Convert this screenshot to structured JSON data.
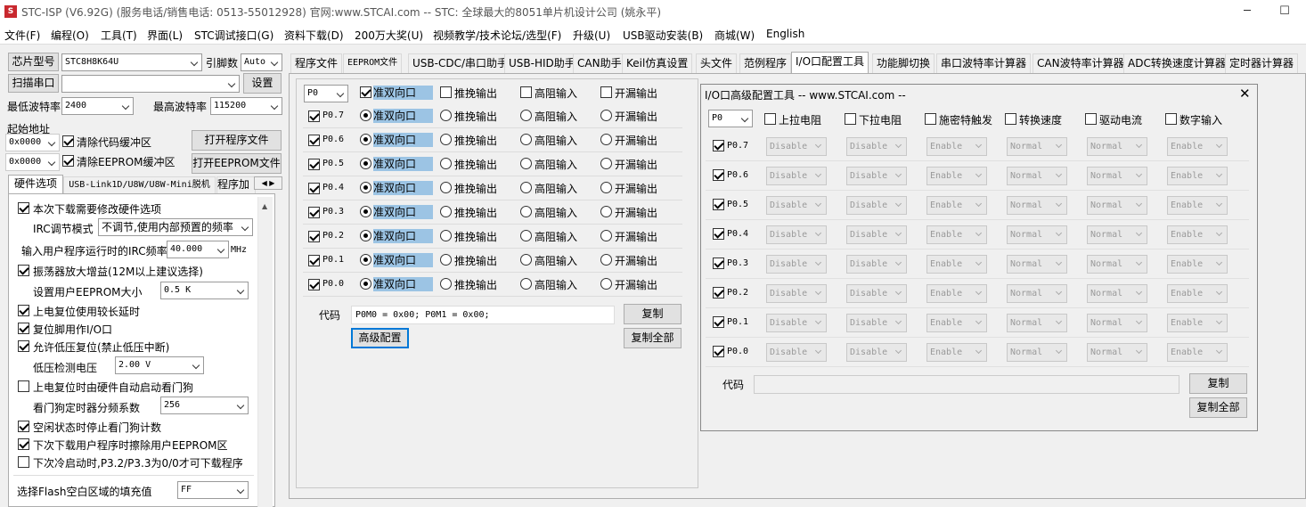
{
  "window": {
    "title": "STC-ISP (V6.92G) (服务电话/销售电话: 0513-55012928) 官网:www.STCAI.com  -- STC: 全球最大的8051单片机设计公司 (姚永平)",
    "minimize": "─",
    "maximize": "☐"
  },
  "menu": [
    "文件(F)",
    "编程(O)",
    "工具(T)",
    "界面(L)",
    "STC调试接口(G)",
    "资料下载(D)",
    "200万大奖(U)",
    "视频教学/技术论坛/选型(F)",
    "升级(U)",
    "USB驱动安装(B)",
    "商城(W)",
    "English"
  ],
  "left": {
    "chip_label": "芯片型号",
    "chip_value": "STC8H8K64U",
    "pin_label": "引脚数",
    "pin_value": "Auto",
    "scan_label": "扫描串口",
    "settings_label": "设置",
    "min_baud_label": "最低波特率",
    "min_baud_value": "2400",
    "max_baud_label": "最高波特率",
    "max_baud_value": "115200",
    "start_addr_label": "起始地址",
    "addr1": "0x0000",
    "clear_code_label": "清除代码缓冲区",
    "open_prog_label": "打开程序文件",
    "addr2": "0x0000",
    "clear_eeprom_label": "清除EEPROM缓冲区",
    "open_eeprom_label": "打开EEPROM文件",
    "subtabs": [
      "硬件选项",
      "USB-Link1D/U8W/U8W-Mini脱机",
      "程序加"
    ],
    "options": {
      "modify_hw": "本次下载需要修改硬件选项",
      "irc_mode_label": "IRC调节模式",
      "irc_mode_value": "不调节,使用内部预置的频率",
      "irc_freq_label": "输入用户程序运行时的IRC频率",
      "irc_freq_value": "40.000",
      "irc_freq_unit": "MHz",
      "osc_gain": "振荡器放大增益(12M以上建议选择)",
      "eeprom_size_label": "设置用户EEPROM大小",
      "eeprom_size_value": "0.5 K",
      "por_delay": "上电复位使用较长延时",
      "reset_pin_io": "复位脚用作I/O口",
      "lvr": "允许低压复位(禁止低压中断)",
      "lvd_label": "低压检测电压",
      "lvd_value": "2.00 V",
      "wdt_auto": "上电复位时由硬件自动启动看门狗",
      "wdt_div_label": "看门狗定时器分频系数",
      "wdt_div_value": "256",
      "wdt_idle": "空闲状态时停止看门狗计数",
      "erase_eeprom": "下次下载用户程序时擦除用户EEPROM区",
      "cold_boot": "下次冷启动时,P3.2/P3.3为0/0才可下载程序",
      "flash_fill_label": "选择Flash空白区域的填充值",
      "flash_fill_value": "FF"
    }
  },
  "tabs": [
    "程序文件",
    "EEPROM文件",
    "USB-CDC/串口助手",
    "USB-HID助手",
    "CAN助手",
    "Keil仿真设置",
    "头文件",
    "范例程序",
    "I/O口配置工具",
    "功能脚切换",
    "串口波特率计算器",
    "CAN波特率计算器",
    "ADC转换速度计算器",
    "定时器计算器"
  ],
  "io": {
    "port": "P0",
    "modes": [
      "准双向口",
      "推挽输出",
      "高阻输入",
      "开漏输出"
    ],
    "pins": [
      "P0.7",
      "P0.6",
      "P0.5",
      "P0.4",
      "P0.3",
      "P0.2",
      "P0.1",
      "P0.0"
    ],
    "code_label": "代码",
    "code_value": "P0M0 = 0x00; P0M1 = 0x00;",
    "copy_label": "复制",
    "advanced_label": "高级配置",
    "copy_all_label": "复制全部"
  },
  "dialog": {
    "title": "I/O口高级配置工具 -- www.STCAI.com --",
    "close": "✕",
    "port": "P0",
    "headers": [
      "上拉电阻",
      "下拉电阻",
      "施密特触发",
      "转换速度",
      "驱动电流",
      "数字输入"
    ],
    "pins": [
      "P0.7",
      "P0.6",
      "P0.5",
      "P0.4",
      "P0.3",
      "P0.2",
      "P0.1",
      "P0.0"
    ],
    "values": [
      "Disable",
      "Disable",
      "Enable",
      "Normal",
      "Normal",
      "Enable"
    ],
    "code_label": "代码",
    "copy_label": "复制",
    "copy_all_label": "复制全部"
  }
}
